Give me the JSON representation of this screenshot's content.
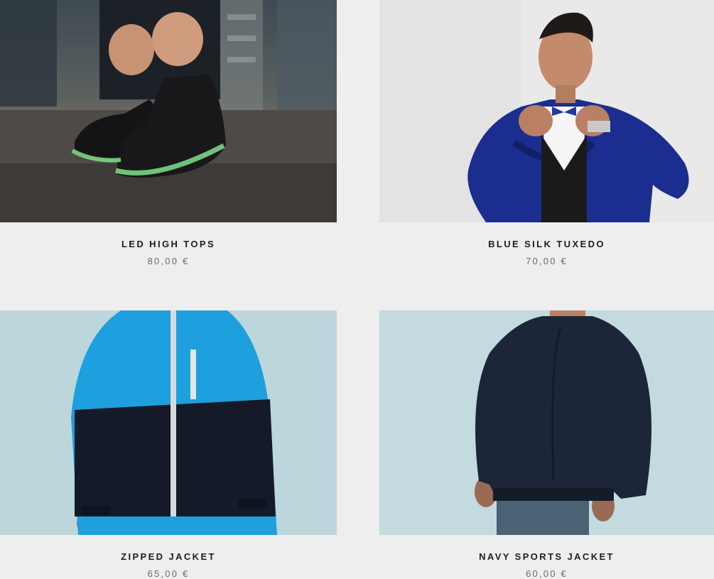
{
  "products": [
    {
      "name": "LED HIGH TOPS",
      "price": "80,00 €",
      "image": "led-sneakers-photo"
    },
    {
      "name": "BLUE SILK TUXEDO",
      "price": "70,00 €",
      "image": "blue-tuxedo-photo"
    },
    {
      "name": "ZIPPED JACKET",
      "price": "65,00 €",
      "image": "zipped-jacket-photo"
    },
    {
      "name": "NAVY SPORTS JACKET",
      "price": "60,00 €",
      "image": "navy-jacket-photo"
    }
  ],
  "colors": {
    "page_background": "#eeeeee",
    "title_text": "#1e1e1e",
    "price_text": "#6b6b6b"
  }
}
